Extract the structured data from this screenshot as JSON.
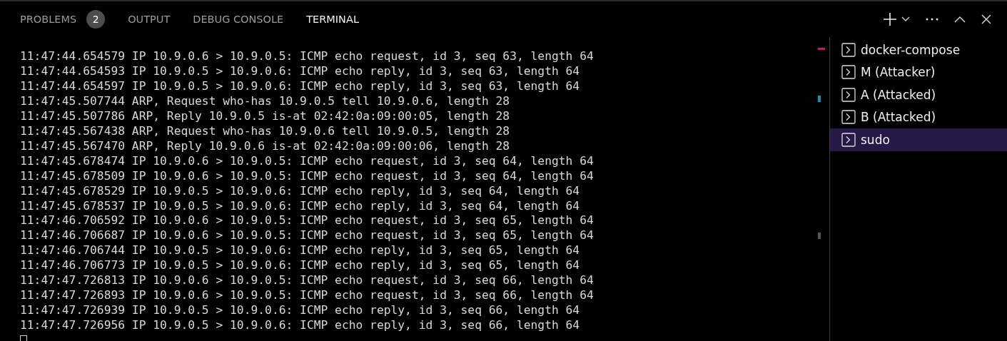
{
  "tabs": [
    {
      "label": "PROBLEMS",
      "badge": "2",
      "selected": false
    },
    {
      "label": "OUTPUT",
      "selected": false
    },
    {
      "label": "DEBUG CONSOLE",
      "selected": false
    },
    {
      "label": "TERMINAL",
      "selected": true
    }
  ],
  "terminal": {
    "lines": [
      "11:47:44.654579 IP 10.9.0.6 > 10.9.0.5: ICMP echo request, id 3, seq 63, length 64",
      "11:47:44.654593 IP 10.9.0.5 > 10.9.0.6: ICMP echo reply, id 3, seq 63, length 64",
      "11:47:44.654597 IP 10.9.0.5 > 10.9.0.6: ICMP echo reply, id 3, seq 63, length 64",
      "11:47:45.507744 ARP, Request who-has 10.9.0.5 tell 10.9.0.6, length 28",
      "11:47:45.507786 ARP, Reply 10.9.0.5 is-at 02:42:0a:09:00:05, length 28",
      "11:47:45.567438 ARP, Request who-has 10.9.0.6 tell 10.9.0.5, length 28",
      "11:47:45.567470 ARP, Reply 10.9.0.6 is-at 02:42:0a:09:00:06, length 28",
      "11:47:45.678474 IP 10.9.0.6 > 10.9.0.5: ICMP echo request, id 3, seq 64, length 64",
      "11:47:45.678509 IP 10.9.0.6 > 10.9.0.5: ICMP echo request, id 3, seq 64, length 64",
      "11:47:45.678529 IP 10.9.0.5 > 10.9.0.6: ICMP echo reply, id 3, seq 64, length 64",
      "11:47:45.678537 IP 10.9.0.5 > 10.9.0.6: ICMP echo reply, id 3, seq 64, length 64",
      "11:47:46.706592 IP 10.9.0.6 > 10.9.0.5: ICMP echo request, id 3, seq 65, length 64",
      "11:47:46.706687 IP 10.9.0.6 > 10.9.0.5: ICMP echo request, id 3, seq 65, length 64",
      "11:47:46.706744 IP 10.9.0.5 > 10.9.0.6: ICMP echo reply, id 3, seq 65, length 64",
      "11:47:46.706773 IP 10.9.0.5 > 10.9.0.6: ICMP echo reply, id 3, seq 65, length 64",
      "11:47:47.726813 IP 10.9.0.6 > 10.9.0.5: ICMP echo request, id 3, seq 66, length 64",
      "11:47:47.726893 IP 10.9.0.6 > 10.9.0.5: ICMP echo request, id 3, seq 66, length 64",
      "11:47:47.726939 IP 10.9.0.5 > 10.9.0.6: ICMP echo reply, id 3, seq 66, length 64",
      "11:47:47.726956 IP 10.9.0.5 > 10.9.0.6: ICMP echo reply, id 3, seq 66, length 64"
    ]
  },
  "terminal_list": [
    {
      "label": "docker-compose",
      "selected": false
    },
    {
      "label": "M (Attacker)",
      "selected": false
    },
    {
      "label": "A (Attacked)",
      "selected": false
    },
    {
      "label": "B (Attacked)",
      "selected": false
    },
    {
      "label": "sudo",
      "selected": true
    }
  ]
}
